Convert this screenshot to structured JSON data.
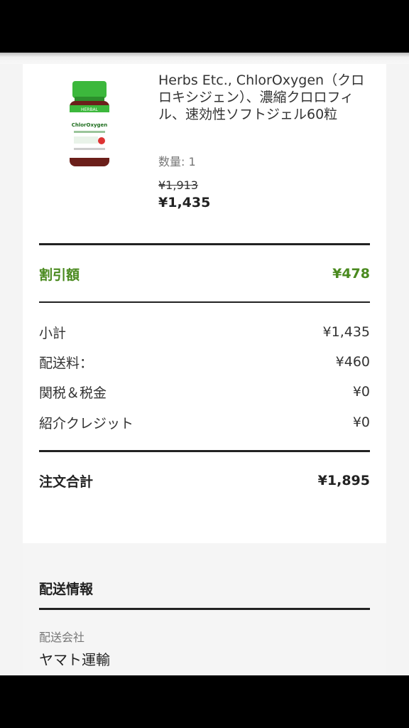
{
  "product": {
    "image_icon": "supplement-bottle-image",
    "image_brand_text": "HERBAL",
    "image_label_text": "ChlorOxygen",
    "name": "Herbs Etc., ChlorOxygen（クロロキシジェン）、濃縮クロロフィル、速効性ソフトジェル60粒",
    "quantity": "数量: 1",
    "original_price": "¥1,913",
    "price": "¥1,435"
  },
  "summary": {
    "discount": {
      "label": "割引額",
      "value": "¥478"
    },
    "rows": [
      {
        "label": "小計",
        "value": "¥1,435"
      },
      {
        "label": "配送料：",
        "value": "¥460"
      },
      {
        "label": "関税＆税金",
        "value": "¥0"
      },
      {
        "label": "紹介クレジット",
        "value": "¥0"
      }
    ],
    "total": {
      "label": "注文合計",
      "value": "¥1,895"
    }
  },
  "shipping": {
    "title": "配送情報",
    "carrier_label": "配送会社",
    "carrier": "ヤマト運輸"
  },
  "colors": {
    "discount_green": "#4a8a1f",
    "rule_dark": "#222222",
    "muted_gray": "#777777"
  }
}
